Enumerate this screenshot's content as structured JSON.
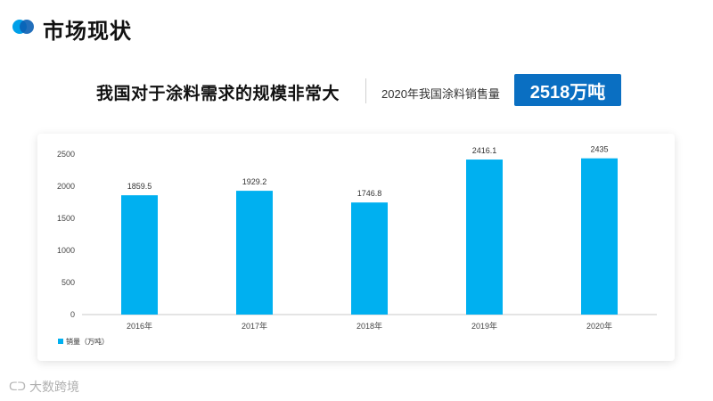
{
  "header": {
    "title": "市场现状",
    "accent_colors": [
      "#00a0e9",
      "#0a5fb4"
    ]
  },
  "summary": {
    "headline": "我国对于涂料需求的规模非常大",
    "sales_label": "2020年我国涂料销售量",
    "sales_value": "2518万吨",
    "badge_color": "#0a6fc2"
  },
  "chart_data": {
    "type": "bar",
    "categories": [
      "2016年",
      "2017年",
      "2018年",
      "2019年",
      "2020年"
    ],
    "series": [
      {
        "name": "销量（万吨）",
        "values": [
          1859.5,
          1929.2,
          1746.8,
          2416.1,
          2435
        ],
        "color": "#00b0f0"
      }
    ],
    "data_labels": [
      "1859.5",
      "1929.2",
      "1746.8",
      "2416.1",
      "2435"
    ],
    "yticks": [
      0,
      500,
      1000,
      1500,
      2000,
      2500
    ],
    "ylim": [
      0,
      2500
    ],
    "legend_position": "bottom-left",
    "grid": false
  },
  "watermark": {
    "text": "大数跨境"
  }
}
